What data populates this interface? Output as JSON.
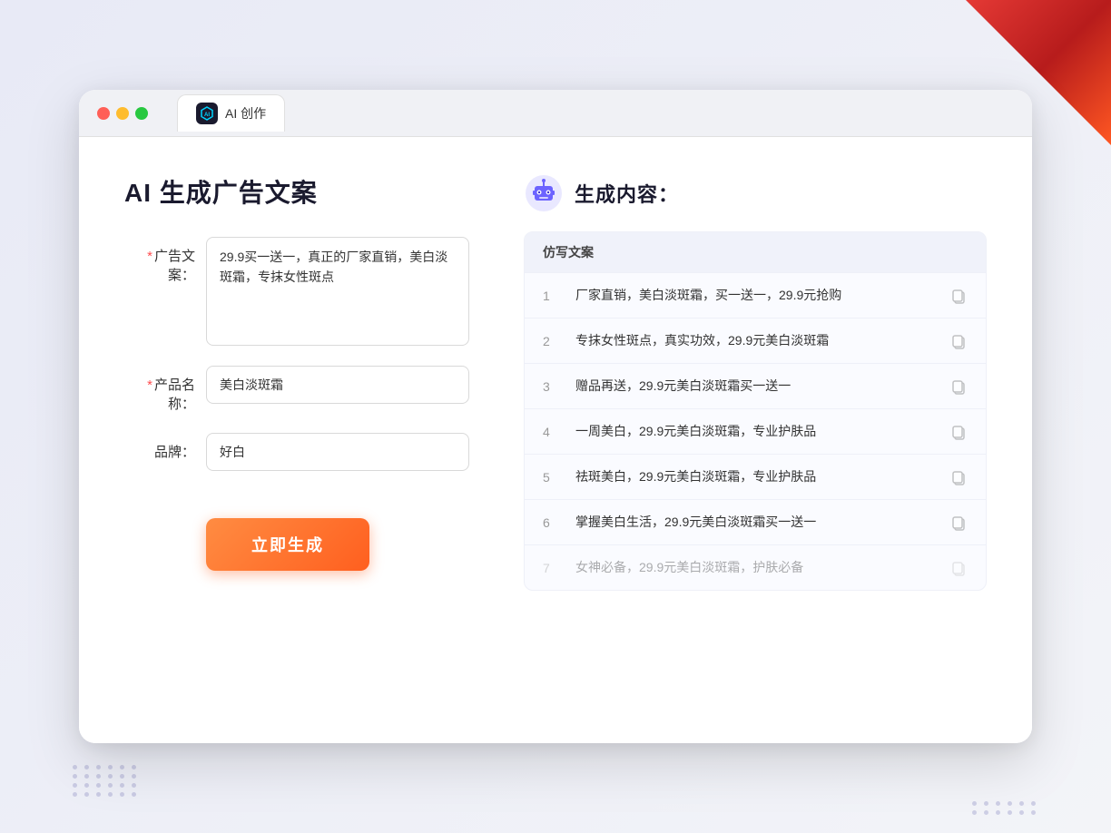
{
  "background": {
    "triangle_color": "#cc2200"
  },
  "browser": {
    "tab_label": "AI 创作",
    "tab_icon_text": "AI"
  },
  "left_panel": {
    "page_title": "AI 生成广告文案",
    "form": {
      "ad_text_label": "广告文案：",
      "ad_text_required": "*",
      "ad_text_value": "29.9买一送一，真正的厂家直销，美白淡斑霜，专抹女性斑点",
      "product_name_label": "产品名称：",
      "product_name_required": "*",
      "product_name_value": "美白淡斑霜",
      "brand_label": "品牌：",
      "brand_value": "好白"
    },
    "submit_button_label": "立即生成"
  },
  "right_panel": {
    "header_title": "生成内容：",
    "table_header": "仿写文案",
    "results": [
      {
        "number": "1",
        "text": "厂家直销，美白淡斑霜，买一送一，29.9元抢购",
        "faded": false
      },
      {
        "number": "2",
        "text": "专抹女性斑点，真实功效，29.9元美白淡斑霜",
        "faded": false
      },
      {
        "number": "3",
        "text": "赠品再送，29.9元美白淡斑霜买一送一",
        "faded": false
      },
      {
        "number": "4",
        "text": "一周美白，29.9元美白淡斑霜，专业护肤品",
        "faded": false
      },
      {
        "number": "5",
        "text": "祛斑美白，29.9元美白淡斑霜，专业护肤品",
        "faded": false
      },
      {
        "number": "6",
        "text": "掌握美白生活，29.9元美白淡斑霜买一送一",
        "faded": false
      },
      {
        "number": "7",
        "text": "女神必备，29.9元美白淡斑霜，护肤必备",
        "faded": true
      }
    ]
  }
}
